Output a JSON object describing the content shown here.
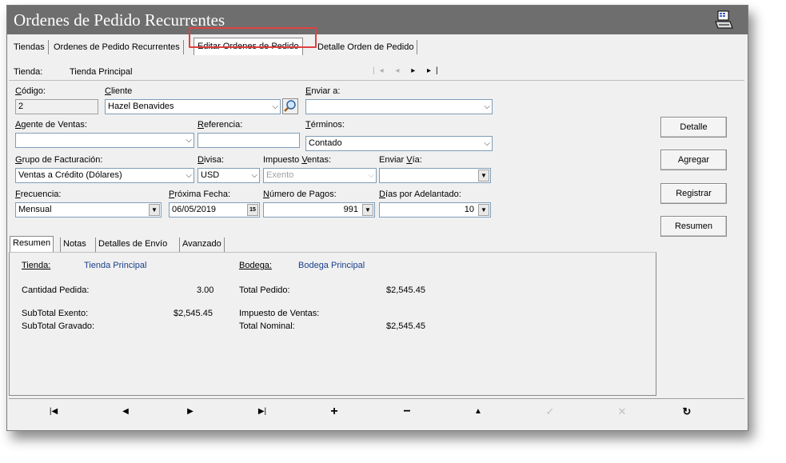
{
  "window": {
    "title": "Ordenes de Pedido Recurrentes"
  },
  "tabs": [
    {
      "label": "Tiendas"
    },
    {
      "label": "Ordenes de Pedido Recurrentes"
    },
    {
      "label": "Editar Ordenes de Pedido"
    },
    {
      "label": "Detalle Orden de Pedido"
    }
  ],
  "storebar": {
    "label": "Tienda:",
    "value": "Tienda Principal",
    "nav": "|◂ ◂ ▸ ▸|"
  },
  "form": {
    "codigo": {
      "label": "Código:",
      "value": "2"
    },
    "cliente": {
      "label": "Cliente",
      "value": "Hazel Benavides"
    },
    "enviar_a": {
      "label": "Enviar a:",
      "value": ""
    },
    "agente": {
      "label": "Agente de Ventas:",
      "value": ""
    },
    "referencia": {
      "label": "Referencia:",
      "value": ""
    },
    "terminos": {
      "label": "Términos:",
      "value": "Contado"
    },
    "grupo": {
      "label": "Grupo de Facturación:",
      "value": "Ventas a Crédito (Dólares)"
    },
    "divisa": {
      "label": "Divisa:",
      "value": "USD"
    },
    "impuesto": {
      "label": "Impuesto Ventas:",
      "value": "Exento"
    },
    "enviar_via": {
      "label": "Enviar Vía:",
      "value": ""
    },
    "frecuencia": {
      "label": "Frecuencia:",
      "value": "Mensual"
    },
    "proxima_fecha": {
      "label": "Próxima Fecha:",
      "value": "06/05/2019"
    },
    "numero_pagos": {
      "label": "Número de Pagos:",
      "value": "991"
    },
    "dias_adelantado": {
      "label": "Días por Adelantado:",
      "value": "10"
    }
  },
  "side_buttons": [
    "Detalle",
    "Agregar",
    "Registrar",
    "Resumen"
  ],
  "inner_tabs": [
    "Resumen",
    "Notas",
    "Detalles de Envío",
    "Avanzado"
  ],
  "summary": {
    "tienda_label": "Tienda:",
    "tienda_value": "Tienda Principal",
    "bodega_label": "Bodega:",
    "bodega_value": "Bodega Principal",
    "cantidad_label": "Cantidad Pedida:",
    "cantidad_value": "3.00",
    "total_pedido_label": "Total Pedido:",
    "total_pedido_value": "$2,545.45",
    "subtotal_exento_label": "SubTotal Exento:",
    "subtotal_exento_value": "$2,545.45",
    "impuesto_label": "Impuesto de Ventas:",
    "subtotal_gravado_label": "SubTotal Gravado:",
    "total_nominal_label": "Total Nominal:",
    "total_nominal_value": "$2,545.45"
  },
  "colors": {
    "titlebar": "#6e6e6e",
    "highlight": "#e04040",
    "link_blue": "#1a3f8c"
  }
}
